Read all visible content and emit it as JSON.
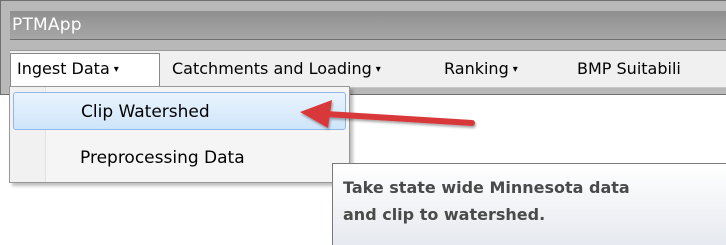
{
  "window": {
    "title": "PTMApp"
  },
  "menubar": {
    "items": [
      {
        "label": "Ingest Data",
        "has_dropdown": true,
        "open": true
      },
      {
        "label": "Catchments and Loading",
        "has_dropdown": true
      },
      {
        "label": "Ranking",
        "has_dropdown": true
      },
      {
        "label": "BMP Suitabili",
        "has_dropdown": false
      }
    ],
    "caret_glyph": "▾"
  },
  "dropdown": {
    "items": [
      {
        "label": "Clip Watershed",
        "highlighted": true
      },
      {
        "label": "Preprocessing Data",
        "highlighted": false
      }
    ]
  },
  "tooltip": {
    "line1": "Take state wide Minnesota data",
    "line2": "and clip to watershed."
  },
  "annotation": {
    "arrow_color": "#d9393a"
  }
}
